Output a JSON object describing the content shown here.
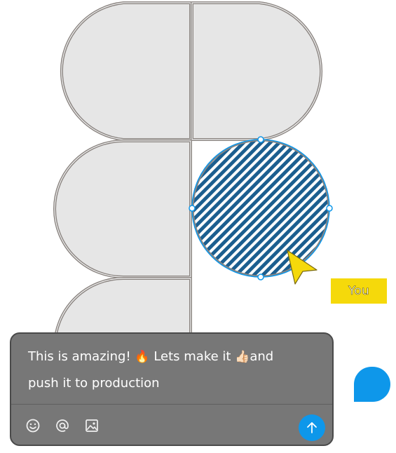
{
  "cursor_label": "You",
  "comment": {
    "line1_start": "This is amazing! ",
    "emoji_fire": "🔥",
    "line1_mid": " Lets make it ",
    "emoji_thumbs": "👍🏻",
    "line1_end": "and",
    "line2": "push it to production"
  },
  "toolbar": {
    "emoji_icon": "smiley-icon",
    "mention_icon": "at-sign-icon",
    "image_icon": "image-icon",
    "send_icon": "arrow-up-icon"
  },
  "colors": {
    "shape_fill": "#e6e6e6",
    "shape_outline": "#8a8480",
    "selection_blue": "#0e97ea",
    "stripe_dark": "#1b5e8f",
    "cursor_yellow": "#f5d90b",
    "card_bg": "#777777"
  }
}
